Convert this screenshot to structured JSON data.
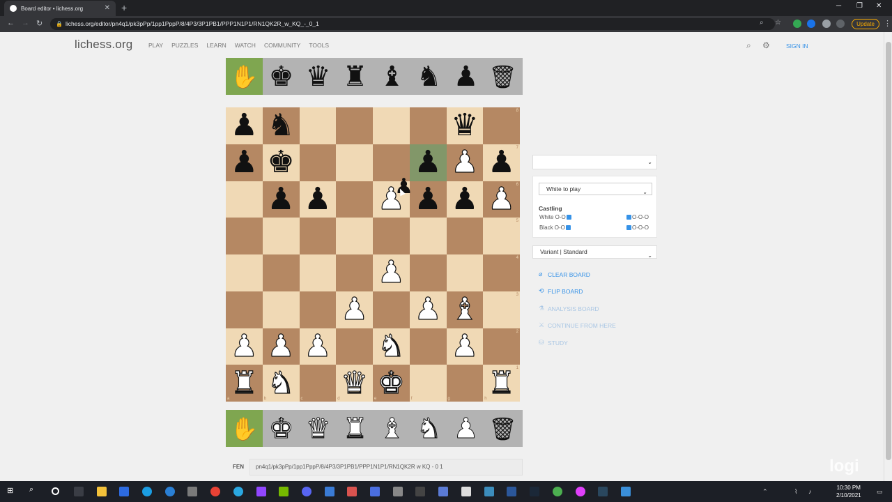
{
  "browser": {
    "tab_title": "Board editor • lichess.org",
    "url": "lichess.org/editor/pn4q1/pk3pPp/1pp1PppP/8/4P3/3P1PB1/PPP1N1P1/RN1QK2R_w_KQ_-_0_1",
    "update_label": "Update"
  },
  "site": {
    "logo": "lichess.org",
    "nav": [
      "PLAY",
      "PUZZLES",
      "LEARN",
      "WATCH",
      "COMMUNITY",
      "TOOLS"
    ],
    "signin": "SIGN IN"
  },
  "spare_top": [
    {
      "icon": "pointer-hand-icon",
      "glyph": "✋",
      "selected": true,
      "color": "black"
    },
    {
      "icon": "black-king-icon",
      "glyph": "♚",
      "color": "black"
    },
    {
      "icon": "black-queen-icon",
      "glyph": "♛",
      "color": "black"
    },
    {
      "icon": "black-rook-icon",
      "glyph": "♜",
      "color": "black"
    },
    {
      "icon": "black-bishop-icon",
      "glyph": "♝",
      "color": "black"
    },
    {
      "icon": "black-knight-icon",
      "glyph": "♞",
      "color": "black"
    },
    {
      "icon": "black-pawn-icon",
      "glyph": "♟",
      "color": "black"
    },
    {
      "icon": "trash-icon",
      "glyph": "🗑",
      "color": "black"
    }
  ],
  "spare_bottom": [
    {
      "icon": "pointer-hand-icon",
      "glyph": "✋",
      "selected": true,
      "color": "black"
    },
    {
      "icon": "white-king-icon",
      "glyph": "♚",
      "color": "white"
    },
    {
      "icon": "white-queen-icon",
      "glyph": "♛",
      "color": "white"
    },
    {
      "icon": "white-rook-icon",
      "glyph": "♜",
      "color": "white"
    },
    {
      "icon": "white-bishop-icon",
      "glyph": "♝",
      "color": "white"
    },
    {
      "icon": "white-knight-icon",
      "glyph": "♞",
      "color": "white"
    },
    {
      "icon": "white-pawn-icon",
      "glyph": "♟",
      "color": "white"
    },
    {
      "icon": "trash-icon",
      "glyph": "🗑",
      "color": "black"
    }
  ],
  "board": {
    "ranks": [
      "pn4q1",
      "pk3pPp",
      "1pp1PppP",
      "8",
      "4P3",
      "3P1PB1",
      "PPP1N1P1",
      "RN1QK2R"
    ],
    "highlight": [
      "f7"
    ],
    "rank_labels": [
      "8",
      "7",
      "6",
      "5",
      "4",
      "3",
      "2",
      "1"
    ],
    "file_labels": [
      "a",
      "b",
      "c",
      "d",
      "e",
      "f",
      "g",
      "h"
    ],
    "dragging_piece": "black-pawn"
  },
  "panel": {
    "position_select": "",
    "turn": "White to play",
    "castling_title": "Castling",
    "white_oo": "White O-O",
    "white_ooo": "O-O-O",
    "black_oo": "Black O-O",
    "black_ooo": "O-O-O",
    "variant": "Variant | Standard",
    "actions": [
      {
        "label": "CLEAR BOARD",
        "icon": "clear-icon",
        "enabled": true
      },
      {
        "label": "FLIP BOARD",
        "icon": "flip-icon",
        "enabled": true
      },
      {
        "label": "ANALYSIS BOARD",
        "icon": "analysis-icon",
        "enabled": false
      },
      {
        "label": "CONTINUE FROM HERE",
        "icon": "continue-icon",
        "enabled": false
      },
      {
        "label": "STUDY",
        "icon": "study-icon",
        "enabled": false
      }
    ]
  },
  "fen": {
    "label": "FEN",
    "value": "pn4q1/pk3pPp/1pp1PppP/8/4P3/3P1PB1/PPP1N1P1/RN1QK2R w KQ - 0 1"
  },
  "watermark": "logi",
  "clock": {
    "time": "10:30 PM",
    "date": "2/10/2021"
  }
}
